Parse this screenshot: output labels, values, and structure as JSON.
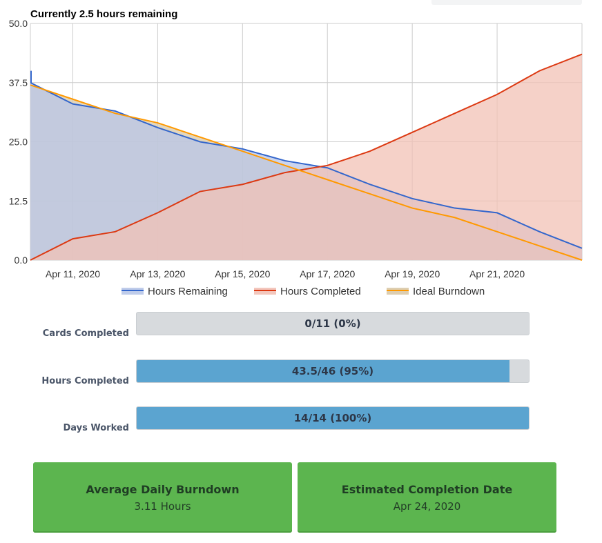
{
  "chart_data": {
    "type": "area",
    "title": "Currently 2.5 hours remaining",
    "ylim": [
      0,
      50
    ],
    "y_ticks": [
      "0.0",
      "12.5",
      "25.0",
      "37.5",
      "50.0"
    ],
    "x_tick_labels": [
      "Apr 11, 2020",
      "Apr 13, 2020",
      "Apr 15, 2020",
      "Apr 17, 2020",
      "Apr 19, 2020",
      "Apr 21, 2020"
    ],
    "x": [
      "Apr 10, 2020",
      "Apr 11, 2020",
      "Apr 12, 2020",
      "Apr 13, 2020",
      "Apr 14, 2020",
      "Apr 15, 2020",
      "Apr 16, 2020",
      "Apr 17, 2020",
      "Apr 18, 2020",
      "Apr 19, 2020",
      "Apr 20, 2020",
      "Apr 21, 2020",
      "Apr 22, 2020",
      "Apr 23, 2020"
    ],
    "grid": true,
    "legend_position": "bottom",
    "series": [
      {
        "name": "Hours Remaining",
        "color": "#3366cc",
        "fill": "#b8c6e8",
        "values": [
          37.5,
          33,
          31.5,
          28,
          25,
          23.5,
          21,
          19.5,
          16,
          13,
          11,
          10,
          6,
          2.5
        ]
      },
      {
        "name": "Hours Completed",
        "color": "#dc3912",
        "fill": "#f2c1b6",
        "values": [
          0,
          4.5,
          6,
          10,
          14.5,
          16,
          18.5,
          20,
          23,
          27,
          31,
          35,
          40,
          43.5
        ]
      },
      {
        "name": "Ideal Burndown",
        "color": "#ff9900",
        "fill": "#d9c9a8",
        "values": [
          37,
          34,
          31,
          29,
          26,
          23,
          20,
          17,
          14,
          11,
          9,
          6,
          3,
          0
        ]
      }
    ]
  },
  "stats": [
    {
      "label": "Cards Completed",
      "text": "0/11 (0%)",
      "fraction": 0.0
    },
    {
      "label": "Hours Completed",
      "text": "43.5/46 (95%)",
      "fraction": 0.95
    },
    {
      "label": "Days Worked",
      "text": "14/14 (100%)",
      "fraction": 1.0
    }
  ],
  "cards": [
    {
      "title": "Average Daily Burndown",
      "value": "3.11 Hours"
    },
    {
      "title": "Estimated Completion Date",
      "value": "Apr 24, 2020"
    }
  ]
}
